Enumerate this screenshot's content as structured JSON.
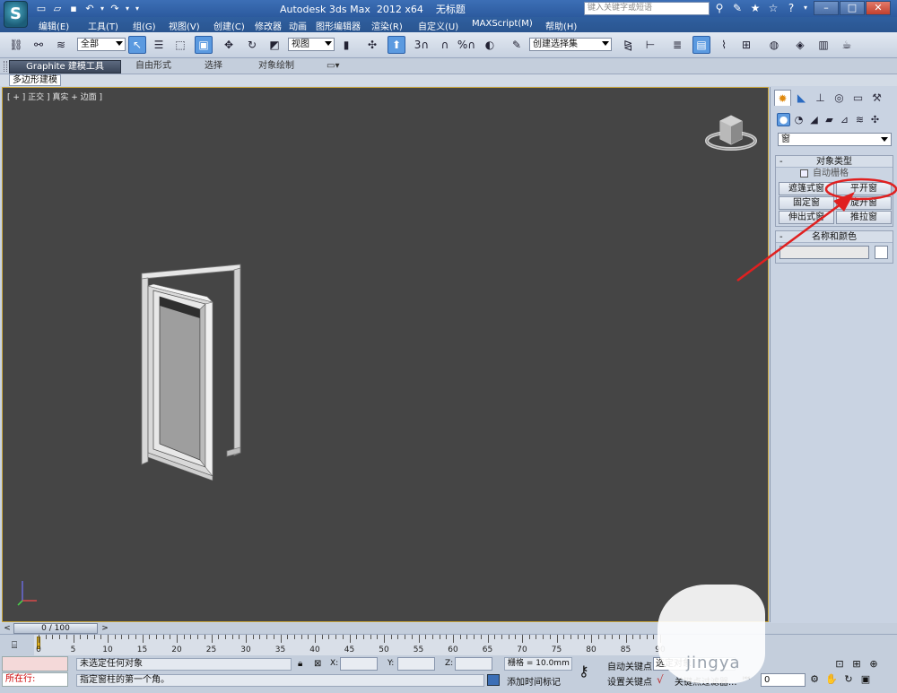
{
  "title_bar": {
    "app_logo": "S",
    "window_title": "Autodesk 3ds Max  2012 x64    无标题",
    "help_search_placeholder": "键入关键字或短语",
    "win_minimize": "–",
    "win_maximize": "□",
    "win_close": "✕"
  },
  "menu": [
    "编辑(E)",
    "工具(T)",
    "组(G)",
    "视图(V)",
    "创建(C)",
    "修改器",
    "动画",
    "图形编辑器",
    "渲染(R)",
    "自定义(U)",
    "MAXScript(M)",
    "帮助(H)"
  ],
  "toolbar": {
    "selection_filter": "全部",
    "reference_coord": "视图",
    "named_selection": "创建选择集",
    "snap_3": "3",
    "snap_percent": "%"
  },
  "ribbon": {
    "tabs": [
      "Graphite 建模工具",
      "自由形式",
      "选择",
      "对象绘制"
    ],
    "sub_label": "多边形建模"
  },
  "viewport": {
    "label": "[ + ] 正交 ] 真实 + 边面 ]"
  },
  "command_panel": {
    "category": "窗",
    "object_type_title": "对象类型",
    "autogrid_label": "自动栅格",
    "buttons": [
      "遮篷式窗",
      "平开窗",
      "固定窗",
      "旋开窗",
      "伸出式窗",
      "推拉窗"
    ],
    "name_color_title": "名称和颜色",
    "rollout_minus": "-"
  },
  "time": {
    "slider_label": "0 / 100",
    "prev": "<",
    "next": ">",
    "ticks": [
      0,
      5,
      10,
      15,
      20,
      25,
      30,
      35,
      40,
      45,
      50,
      55,
      60,
      65,
      70,
      75,
      80,
      85,
      90
    ]
  },
  "status": {
    "selection_status": "未选定任何对象",
    "prompt": "指定窗柱的第一个角。",
    "running_label": "所在行:",
    "x_label": "X:",
    "y_label": "Y:",
    "z_label": "Z:",
    "grid": "栅格 = 10.0mm",
    "add_time_tag": "添加时间标记",
    "auto_key": "自动关键点",
    "set_key": "设置关键点",
    "selected_object": "选定对象",
    "key_filter": "关键点过滤器...",
    "frame": "0"
  },
  "watermark": "jingya"
}
